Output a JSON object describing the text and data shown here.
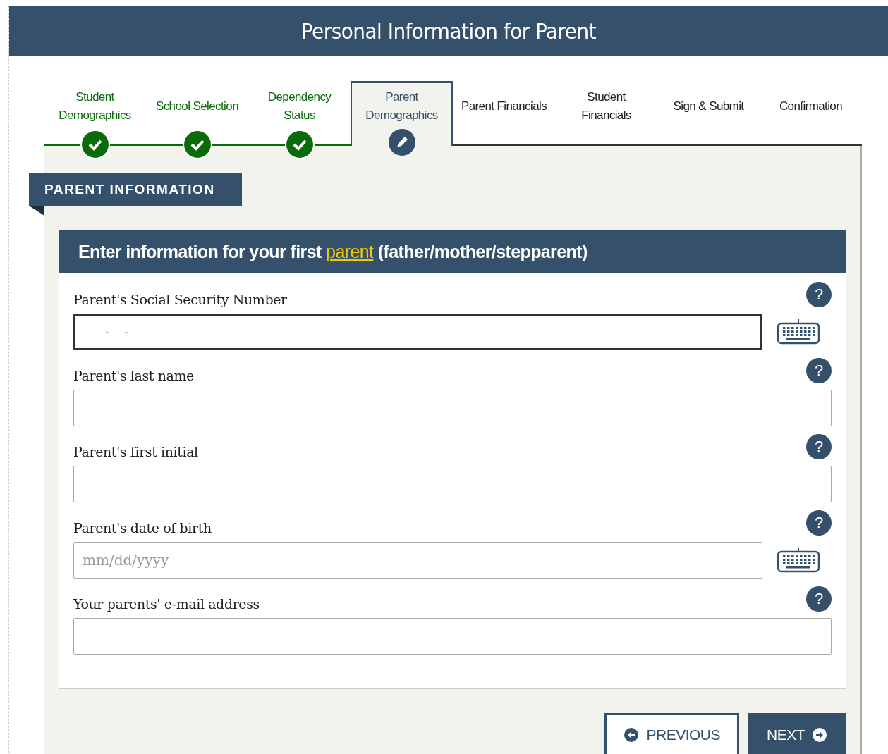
{
  "header": {
    "title": "Personal Information for Parent"
  },
  "steps": [
    {
      "label": "Student Demographics",
      "completed": true,
      "selected": false
    },
    {
      "label": "School Selection",
      "completed": true,
      "selected": false
    },
    {
      "label": "Dependency Status",
      "completed": true,
      "selected": false
    },
    {
      "label": "Parent Demographics",
      "completed": false,
      "selected": true
    },
    {
      "label": "Parent Financials",
      "completed": false,
      "selected": false
    },
    {
      "label": "Student Financials",
      "completed": false,
      "selected": false
    },
    {
      "label": "Sign & Submit",
      "completed": false,
      "selected": false
    },
    {
      "label": "Confirmation",
      "completed": false,
      "selected": false
    }
  ],
  "section": {
    "title": "PARENT INFORMATION"
  },
  "card": {
    "heading_before": "Enter information for your first",
    "heading_link": "parent",
    "heading_after": "(father/mother/stepparent)"
  },
  "fields": [
    {
      "label": "Parent's Social Security Number",
      "help": "?",
      "placeholder": "___-__-____",
      "focused": true,
      "keyboard": true
    },
    {
      "label": "Parent's last name",
      "help": "?",
      "focused": false,
      "keyboard": false
    },
    {
      "label": "Parent's first initial",
      "help": "?",
      "focused": false,
      "keyboard": false
    },
    {
      "label": "Parent's date of birth",
      "help": "?",
      "placeholder": "mm/dd/yyyy",
      "focused": false,
      "keyboard": true
    },
    {
      "label": "Your parents' e-mail address",
      "help": "?",
      "focused": false,
      "keyboard": false
    }
  ],
  "buttons": [
    {
      "label": "PREVIOUS",
      "kind": "secondary"
    },
    {
      "label": "NEXT",
      "kind": "primary"
    }
  ]
}
